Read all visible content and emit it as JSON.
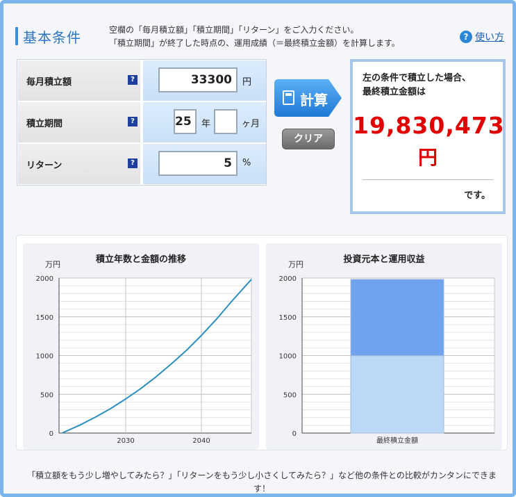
{
  "header": {
    "title": "基本条件",
    "description_line1": "空欄の「毎月積立額」「積立期間」「リターン」をご入力ください。",
    "description_line2": "「積立期間」が終了した時点の、運用成績（＝最終積立金額）を計算します。",
    "help_label": "使い方"
  },
  "form": {
    "monthly": {
      "label": "毎月積立額",
      "value": "33300",
      "unit": "円"
    },
    "period": {
      "label": "積立期間",
      "years_value": "25",
      "years_unit": "年",
      "months_value": "",
      "months_unit": "ヶ月"
    },
    "return": {
      "label": "リターン",
      "value": "5",
      "unit": "%"
    }
  },
  "buttons": {
    "calc_label": "計算",
    "clear_label": "クリア"
  },
  "result": {
    "lead_line1": "左の条件で積立した場合、",
    "lead_line2": "最終積立金額は",
    "amount": "19,830,473",
    "yen": "円",
    "tail": "です。"
  },
  "colors": {
    "result_red": "#e00000",
    "line": "#2a8fbf",
    "bar_top": "#6fa3f0",
    "bar_bottom": "#bcd8f7"
  },
  "chart_data": [
    {
      "type": "line",
      "title": "積立年数と金額の推移",
      "ylabel": "万円",
      "ylim": [
        0,
        2000
      ],
      "yticks": [
        0,
        500,
        1000,
        1500,
        2000
      ],
      "xticks": [
        2030,
        2040
      ],
      "xlim": [
        2021.2,
        2046.6
      ],
      "x": [
        2021.6,
        2024,
        2026,
        2028,
        2030,
        2032,
        2034,
        2036,
        2038,
        2040,
        2042,
        2044,
        2046.6
      ],
      "y": [
        0,
        105,
        205,
        315,
        440,
        575,
        725,
        890,
        1065,
        1260,
        1470,
        1700,
        1983
      ]
    },
    {
      "type": "bar",
      "title": "投資元本と運用収益",
      "ylabel": "万円",
      "ylim": [
        0,
        2000
      ],
      "yticks": [
        0,
        500,
        1000,
        1500,
        2000
      ],
      "categories": [
        "最終積立金額"
      ],
      "series": [
        {
          "values": [
            999
          ]
        },
        {
          "values": [
            984
          ]
        }
      ]
    }
  ],
  "footer": {
    "line1": "「積立額をもう少し増やしてみたら？」「リターンをもう少し小さくしてみたら？」など他の条件との比較がカンタンにできま",
    "line2": "す！"
  }
}
